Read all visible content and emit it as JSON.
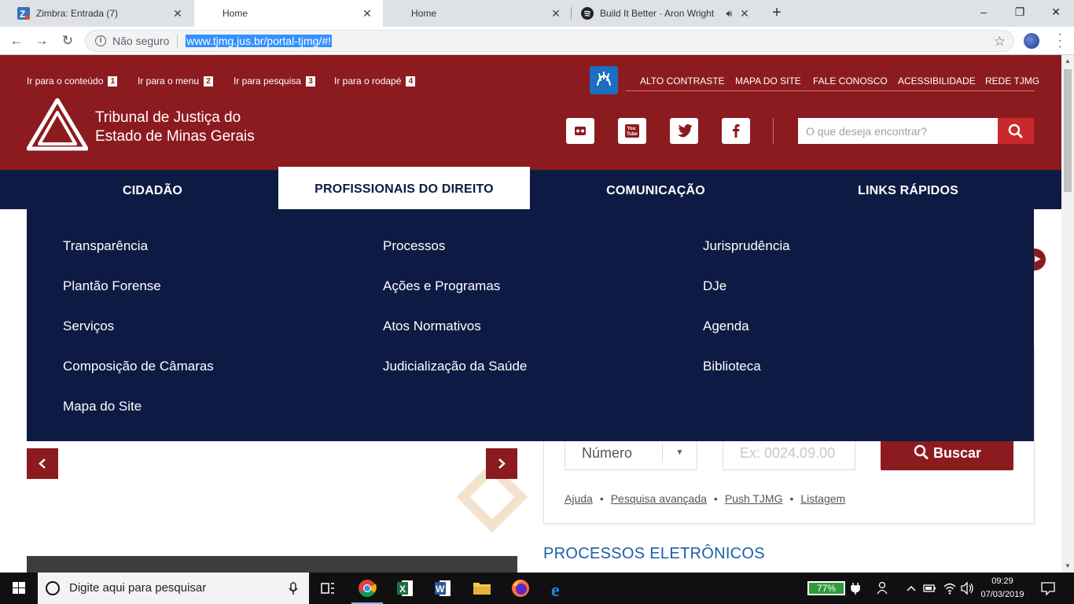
{
  "browser": {
    "tabs": [
      {
        "title": "Zimbra: Entrada (7)",
        "active": false,
        "audio": false
      },
      {
        "title": "Home",
        "active": true,
        "audio": false
      },
      {
        "title": "Home",
        "active": false,
        "audio": false
      },
      {
        "title": "Build It Better · Aron Wright",
        "active": false,
        "audio": true
      }
    ],
    "new_tab_label": "+",
    "window_buttons": {
      "minimize": "–",
      "maximize": "❐",
      "close": "✕"
    },
    "nav": {
      "back": "←",
      "forward": "→",
      "reload": "↻"
    },
    "security_label": "Não seguro",
    "url": "www.tjmg.jus.br/portal-tjmg/#!"
  },
  "site": {
    "skip_links": [
      {
        "label": "Ir para o conteúdo",
        "key": "1"
      },
      {
        "label": "Ir para o menu",
        "key": "2"
      },
      {
        "label": "Ir para pesquisa",
        "key": "3"
      },
      {
        "label": "Ir para o rodapé",
        "key": "4"
      }
    ],
    "top_links": [
      "ALTO CONTRASTE",
      "MAPA DO SITE",
      "FALE CONOSCO",
      "ACESSIBILIDADE",
      "REDE TJMG"
    ],
    "brand_line1": "Tribunal de Justiça do",
    "brand_line2": "Estado de Minas Gerais",
    "social": [
      "flickr-icon",
      "youtube-icon",
      "twitter-icon",
      "facebook-icon"
    ],
    "search_placeholder": "O que deseja encontrar?",
    "menu": [
      "CIDADÃO",
      "PROFISSIONAIS DO DIREITO",
      "COMUNICAÇÃO",
      "LINKS RÁPIDOS"
    ],
    "active_menu": "PROFISSIONAIS DO DIREITO",
    "dropdown": {
      "col1": [
        "Transparência",
        "Plantão Forense",
        "Serviços",
        "Composição de Câmaras",
        "Mapa do Site"
      ],
      "col2": [
        "Processos",
        "Ações e Programas",
        "Atos Normativos",
        "Judicialização da Saúde"
      ],
      "col3": [
        "Jurisprudência",
        "DJe",
        "Agenda",
        "Biblioteca"
      ]
    },
    "query": {
      "select_value": "Número",
      "input_placeholder": "Ex: 0024.09.00",
      "button_label": "Buscar",
      "links": [
        "Ajuda",
        "Pesquisa avançada",
        "Push TJMG",
        "Listagem"
      ],
      "separator": "•"
    },
    "section_title": "PROCESSOS ELETRÔNICOS",
    "colors": {
      "brand_red": "#8c1b1f",
      "navy": "#0d1b44",
      "link_blue": "#1b5ea8"
    }
  },
  "taskbar": {
    "search_placeholder": "Digite aqui para pesquisar",
    "battery": "77%",
    "time": "09:29",
    "date": "07/03/2019"
  }
}
